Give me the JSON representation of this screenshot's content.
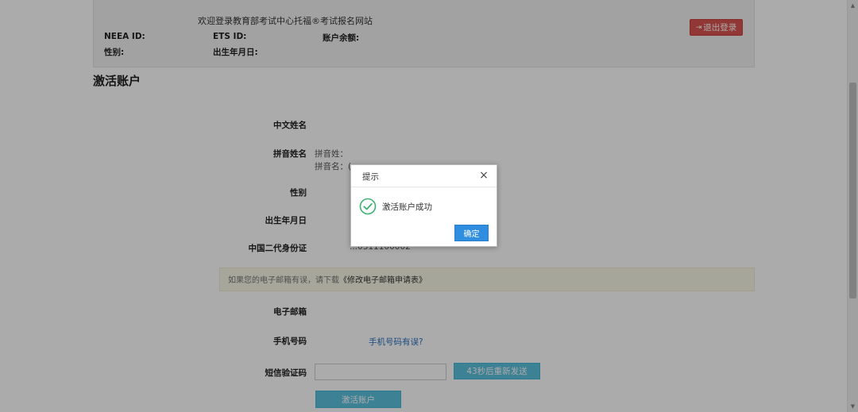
{
  "header": {
    "welcome": "欢迎登录教育部考试中心托福®考试报名网站",
    "neea_id_label": "NEEA ID:",
    "ets_id_label": "ETS ID:",
    "balance_label": "账户余额:",
    "gender_label": "性别:",
    "birthdate_label": "出生年月日:",
    "logout": "退出登录"
  },
  "page_title": "激活账户",
  "form": {
    "chinese_name_label": "中文姓名",
    "pinyin_label": "拼音姓名",
    "pinyin_surname": "拼音姓：",
    "pinyin_given": "拼音名：(",
    "gender_label": "性别",
    "birthdate_label": "出生年月日",
    "id_label": "中国二代身份证",
    "id_value": "...0311100002",
    "notice_prefix": "如果您的电子邮箱有误，请下载",
    "notice_link": "《修改电子邮箱申请表》",
    "email_label": "电子邮箱",
    "phone_label": "手机号码",
    "phone_link": "手机号码有误?",
    "sms_label": "短信验证码",
    "sms_value": "",
    "resend_button": "43秒后重新发送",
    "activate_button": "激活账户"
  },
  "modal": {
    "title": "提示",
    "close": "×",
    "message": "激活账户成功",
    "ok_button": "确定",
    "icon": "check-circle-icon",
    "check_color": "#3cb371"
  }
}
